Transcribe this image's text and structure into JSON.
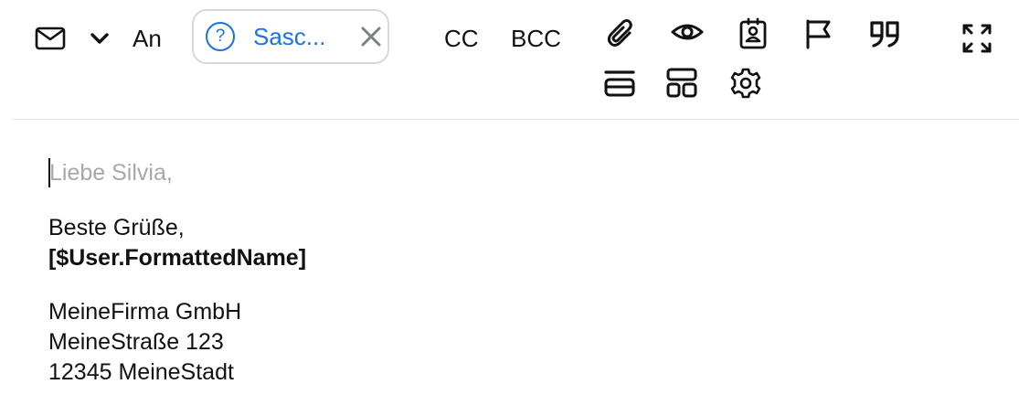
{
  "toolbar": {
    "mail_icon": "envelope-icon",
    "dropdown_icon": "chevron-down-icon",
    "to_label": "An",
    "recipient_chip": {
      "status_icon": "question-circle-icon",
      "status_glyph": "?",
      "label": "Sasc...",
      "remove_icon": "close-icon",
      "accent_color": "#1a73e8"
    },
    "cc_label": "CC",
    "bcc_label": "BCC",
    "actions": [
      "paperclip-icon",
      "eye-icon",
      "contact-badge-icon",
      "flag-icon",
      "quote-icon",
      "expand-icon",
      "layout-rows-icon",
      "layout-grid-icon",
      "gear-icon"
    ]
  },
  "editor": {
    "placeholder": "Liebe Silvia,",
    "signature": {
      "closing": "Beste Grüße,",
      "name_token": "[$User.FormattedName]",
      "company": "MeineFirma GmbH",
      "street": "MeineStraße 123",
      "city": "12345 MeineStadt"
    }
  }
}
